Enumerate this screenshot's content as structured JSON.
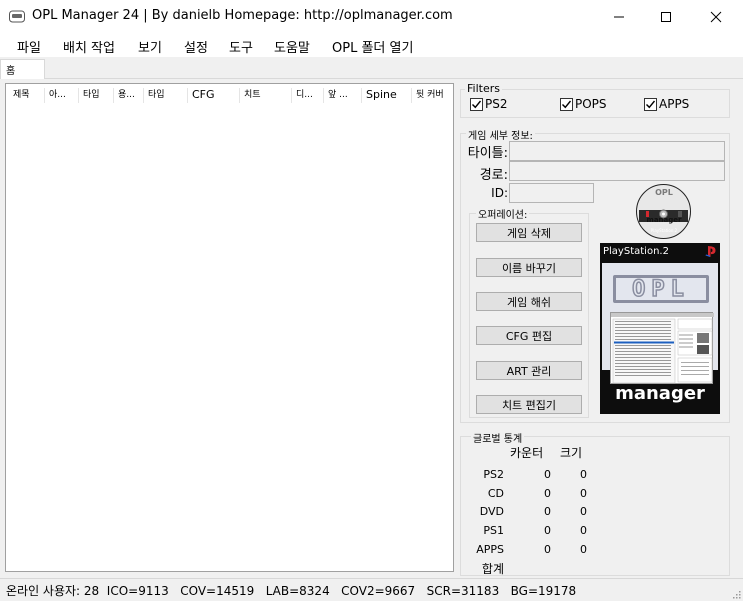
{
  "window": {
    "title": "OPL Manager 24 | By danielb Homepage: http://oplmanager.com",
    "minimize_glyph": "—",
    "maximize_glyph": "☐",
    "close_glyph": "✕"
  },
  "menu": [
    "파일",
    "배치 작업",
    "보기",
    "설정",
    "도구",
    "도움말",
    "OPL 폴더 열기"
  ],
  "tabs": [
    "홈"
  ],
  "game_list": {
    "columns": [
      "제목",
      "아...",
      "타입",
      "용...",
      "타입",
      "CFG",
      "치트",
      "디...",
      "앞 ...",
      "Spine",
      "뒷 커버"
    ]
  },
  "filters": {
    "title": "Filters",
    "items": [
      {
        "label": "PS2",
        "checked": true
      },
      {
        "label": "POPS",
        "checked": true
      },
      {
        "label": "APPS",
        "checked": true
      }
    ]
  },
  "details": {
    "title": "게임 세부 정보:",
    "title_label": "타이틀:",
    "path_label": "경로:",
    "id_label": "ID:",
    "title_value": "",
    "path_value": "",
    "id_value": ""
  },
  "operations": {
    "title": "오퍼레이션:",
    "buttons": [
      "게임 삭제",
      "이름 바꾸기",
      "게임 해쉬",
      "CFG 편집",
      "ART 관리",
      "치트 편집기"
    ]
  },
  "artwork": {
    "disc_title": "OPL",
    "disc_sub": "manager",
    "disc_brand": "PlayStation.2",
    "cover_brand": "PlayStation.2",
    "cover_logo": "OPL",
    "cover_footer": "manager"
  },
  "stats": {
    "title": "글로벌 통계",
    "header_count": "카운터",
    "header_size": "크기",
    "rows": [
      {
        "label": "PS2",
        "count": "0",
        "size": "0"
      },
      {
        "label": "CD",
        "count": "0",
        "size": "0"
      },
      {
        "label": "DVD",
        "count": "0",
        "size": "0"
      },
      {
        "label": "PS1",
        "count": "0",
        "size": "0"
      },
      {
        "label": "APPS",
        "count": "0",
        "size": "0"
      },
      {
        "label": "합계",
        "count": "",
        "size": ""
      }
    ]
  },
  "statusbar": {
    "text": "온라인 사용자: 28  ICO=9113   COV=14519   LAB=8324   COV2=9667   SCR=31183   BG=19178"
  },
  "colors": {
    "accent_blue": "#1c5fbf",
    "ps2_red": "#d4282e"
  }
}
